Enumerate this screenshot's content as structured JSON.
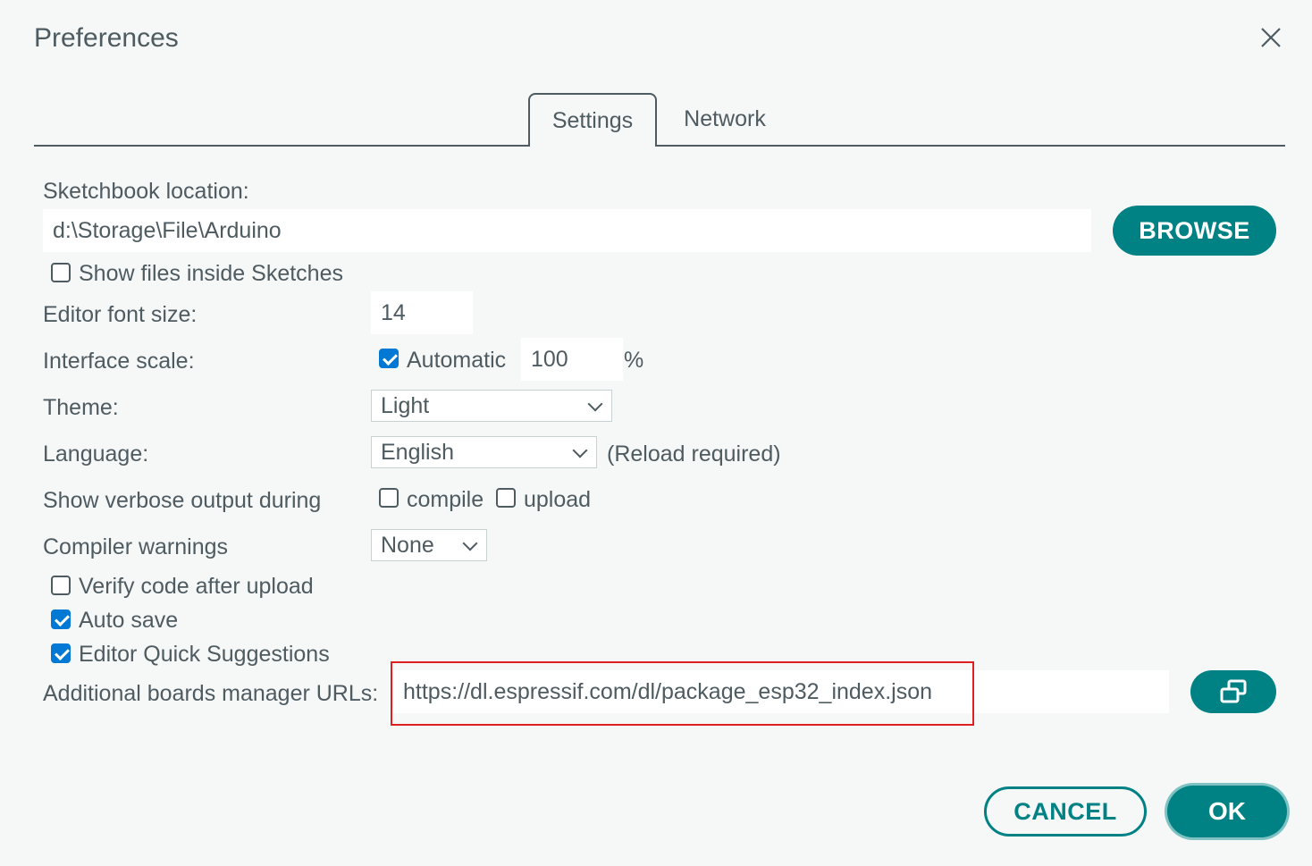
{
  "dialog": {
    "title": "Preferences"
  },
  "tabs": [
    {
      "label": "Settings",
      "active": true
    },
    {
      "label": "Network",
      "active": false
    }
  ],
  "sketchbook": {
    "label": "Sketchbook location:",
    "value": "d:\\Storage\\File\\Arduino",
    "browse_label": "BROWSE"
  },
  "show_files": {
    "label": "Show files inside Sketches",
    "checked": false
  },
  "font_size": {
    "label": "Editor font size:",
    "value": "14"
  },
  "interface_scale": {
    "label": "Interface scale:",
    "automatic_label": "Automatic",
    "automatic_checked": true,
    "value": "100",
    "unit": "%"
  },
  "theme": {
    "label": "Theme:",
    "selected": "Light"
  },
  "language": {
    "label": "Language:",
    "selected": "English",
    "note": "(Reload required)"
  },
  "verbose": {
    "label": "Show verbose output during",
    "compile_label": "compile",
    "compile_checked": false,
    "upload_label": "upload",
    "upload_checked": false
  },
  "compiler_warnings": {
    "label": "Compiler warnings",
    "selected": "None"
  },
  "verify": {
    "label": "Verify code after upload",
    "checked": false
  },
  "autosave": {
    "label": "Auto save",
    "checked": true
  },
  "quick_suggestions": {
    "label": "Editor Quick Suggestions",
    "checked": true
  },
  "boards_urls": {
    "label": "Additional boards manager URLs:",
    "value": "https://dl.espressif.com/dl/package_esp32_index.json",
    "edit_icon": "open-window-icon"
  },
  "footer": {
    "cancel_label": "CANCEL",
    "ok_label": "OK"
  },
  "colors": {
    "accent": "#008184",
    "checkbox": "#0078d4",
    "highlight": "#e02020",
    "text": "#4e5b61",
    "background": "#f6f7f7"
  }
}
